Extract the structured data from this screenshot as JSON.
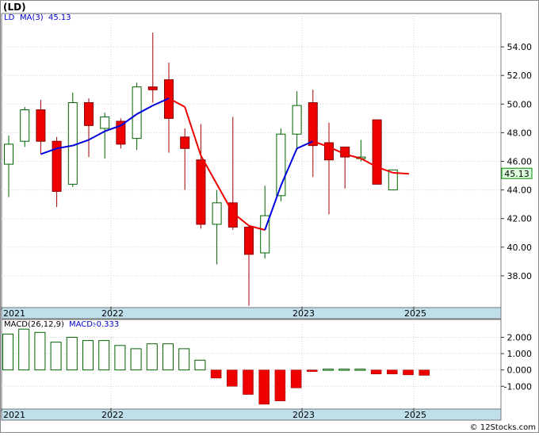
{
  "ticker_label": "(LD)",
  "watermark": "© 12Stocks.com",
  "colors": {
    "up": "#ffffff",
    "up_stroke": "#006400",
    "down": "#ee0000",
    "ma_up": "#0000dd",
    "ma_down": "#ee0000",
    "macd_pos_stroke": "#006400",
    "macd_neg": "#ee0000",
    "axis_band": "#bfdfea",
    "price_badge": "#ddffdd"
  },
  "chart_data": [
    {
      "type": "candlestick",
      "legend": {
        "symbol": "LD",
        "ma_label": "MA(3)",
        "ma_value": "45.13"
      },
      "last_price": "45.13",
      "ylim": [
        36,
        56
      ],
      "yticks": [
        "54.00",
        "52.00",
        "50.00",
        "48.00",
        "46.00",
        "44.00",
        "42.00",
        "40.00",
        "38.00"
      ],
      "xlabels": [
        "2021",
        "2022",
        "2023",
        "2025"
      ],
      "grid": true,
      "ohlc": [
        [
          45.8,
          47.8,
          43.5,
          47.2
        ],
        [
          47.4,
          49.8,
          47.0,
          49.6
        ],
        [
          49.6,
          50.3,
          46.5,
          47.4
        ],
        [
          47.4,
          47.7,
          42.8,
          43.9
        ],
        [
          44.4,
          50.8,
          44.2,
          50.1
        ],
        [
          50.1,
          50.4,
          46.3,
          48.5
        ],
        [
          48.3,
          49.4,
          46.2,
          49.1
        ],
        [
          48.8,
          49.0,
          46.9,
          47.2
        ],
        [
          47.6,
          51.5,
          46.8,
          51.2
        ],
        [
          51.2,
          55.0,
          50.1,
          51.0
        ],
        [
          51.7,
          52.9,
          46.6,
          49.0
        ],
        [
          47.7,
          48.3,
          44.0,
          46.9
        ],
        [
          46.1,
          48.6,
          41.3,
          41.6
        ],
        [
          41.6,
          44.0,
          38.8,
          43.1
        ],
        [
          43.1,
          49.1,
          41.2,
          41.4
        ],
        [
          41.4,
          41.5,
          35.9,
          39.5
        ],
        [
          39.6,
          44.3,
          39.2,
          42.2
        ],
        [
          43.6,
          48.3,
          43.2,
          47.9
        ],
        [
          47.9,
          50.9,
          46.8,
          49.9
        ],
        [
          50.1,
          51.0,
          44.9,
          47.1
        ],
        [
          47.3,
          48.7,
          42.3,
          46.1
        ],
        [
          47.0,
          47.0,
          44.1,
          46.3
        ],
        [
          46.3,
          47.5,
          46.0,
          46.3
        ],
        [
          48.9,
          48.9,
          44.4,
          44.4
        ],
        [
          44.0,
          45.4,
          44.0,
          45.4
        ]
      ],
      "ma": [
        null,
        null,
        46.5,
        46.9,
        47.1,
        47.5,
        48.1,
        48.5,
        49.3,
        49.9,
        50.4,
        49.8,
        46.4,
        44.4,
        42.4,
        41.5,
        41.2,
        44.3,
        46.9,
        47.4,
        47.0,
        46.5,
        46.2,
        45.6,
        45.2,
        45.13
      ]
    },
    {
      "type": "bar",
      "legend": {
        "label": "MACD(26,12,9)",
        "value_label": "MACD:",
        "value": "-0.333"
      },
      "ylim": [
        -2.2,
        2.8
      ],
      "yticks": [
        "2.000",
        "1.000",
        "0.000",
        "-1.000"
      ],
      "xlabels": [
        "2021",
        "2022",
        "2023",
        "2025"
      ],
      "values": [
        2.2,
        2.5,
        2.3,
        1.7,
        2.0,
        1.8,
        1.8,
        1.5,
        1.3,
        1.6,
        1.6,
        1.3,
        0.6,
        -0.5,
        -1.0,
        -1.5,
        -2.1,
        -1.9,
        -1.1,
        -0.1,
        0.05,
        0.05,
        0.05,
        -0.25,
        -0.25,
        -0.3,
        -0.33
      ]
    }
  ]
}
